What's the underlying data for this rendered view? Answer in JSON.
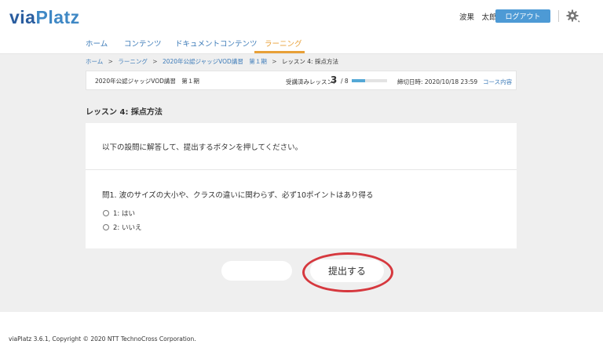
{
  "header": {
    "logo_via": "via",
    "logo_platz": "Platz",
    "user_name": "波果　太郎",
    "logout_label": "ログアウト",
    "settings_icon": "gear-icon"
  },
  "nav": {
    "items": [
      {
        "label": "ホーム"
      },
      {
        "label": "コンテンツ"
      },
      {
        "label": "ドキュメントコンテンツ"
      },
      {
        "label": "ラーニング",
        "active": true
      }
    ]
  },
  "colors": {
    "accent": "#e8a037",
    "link": "#3b7ab8",
    "button_blue": "#4d9ad5",
    "annotation_red": "#d6383e"
  },
  "breadcrumb": {
    "items": [
      "ホーム",
      "ラーニング",
      "2020年公認ジャッジVOD講習　第１期"
    ],
    "current": "レッスン 4: 採点方法",
    "separator": ">"
  },
  "course_info": {
    "course_name": "2020年公認ジャッジVOD講習　第１期",
    "completed_label": "受講済みレッスン:",
    "completed": "3",
    "total": "/ 8",
    "progress_fraction": 0.375,
    "deadline": "締切日時: 2020/10/18 23:59",
    "course_link": "コース内容"
  },
  "lesson": {
    "title": "レッスン 4: 採点方法",
    "instruction": "以下の設問に解答して、提出するボタンを押してください。",
    "question": "問1. 波のサイズの大小や、クラスの違いに関わらず、必ず10ポイントはあり得る",
    "options": [
      "1: はい",
      "2: いいえ"
    ]
  },
  "actions": {
    "submit_label": "提出する"
  },
  "footer": {
    "copyright": "viaPlatz 3.6.1, Copyright © 2020 NTT TechnoCross Corporation."
  }
}
